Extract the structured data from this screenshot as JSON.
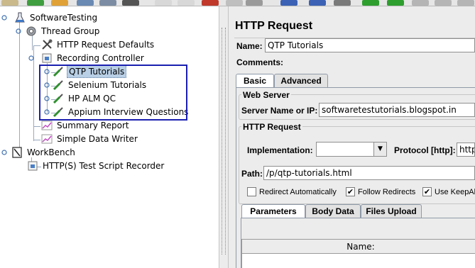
{
  "tree": {
    "items": [
      {
        "label": "SoftwareTesting",
        "icon": "test-plan-icon"
      },
      {
        "label": "Thread Group",
        "icon": "gear-icon"
      },
      {
        "label": "HTTP Request Defaults",
        "icon": "wrench-icon"
      },
      {
        "label": "Recording Controller",
        "icon": "controller-icon"
      },
      {
        "label": "QTP Tutorials",
        "icon": "pipette-icon",
        "selected": true
      },
      {
        "label": "Selenium Tutorials",
        "icon": "pipette-icon"
      },
      {
        "label": "HP ALM QC",
        "icon": "pipette-icon"
      },
      {
        "label": "Appium Interview Questions",
        "icon": "pipette-icon"
      },
      {
        "label": "Summary Report",
        "icon": "chart-icon"
      },
      {
        "label": "Simple Data Writer",
        "icon": "chart-icon"
      },
      {
        "label": "WorkBench",
        "icon": "workbench-icon"
      },
      {
        "label": "HTTP(S) Test Script Recorder",
        "icon": "recorder-icon"
      }
    ]
  },
  "panel": {
    "title": "HTTP Request",
    "name_label": "Name:",
    "name_value": "QTP Tutorials",
    "comments_label": "Comments:",
    "tabs": [
      "Basic",
      "Advanced"
    ],
    "web_server": {
      "title": "Web Server",
      "server_label": "Server Name or IP:",
      "server_value": "softwaretestutorials.blogspot.in"
    },
    "http_request": {
      "title": "HTTP Request",
      "implementation_label": "Implementation:",
      "implementation_value": "",
      "protocol_label": "Protocol [http]:",
      "protocol_value": "http",
      "path_label": "Path:",
      "path_value": "/p/qtp-tutorials.html"
    },
    "checkboxes": [
      {
        "label": "Redirect Automatically",
        "checked": false
      },
      {
        "label": "Follow Redirects",
        "checked": true
      },
      {
        "label": "Use KeepAli",
        "checked": true
      }
    ],
    "sub_tabs": [
      "Parameters",
      "Body Data",
      "Files Upload"
    ],
    "table_header": "Name:"
  },
  "colors": {
    "selection": "#b8cfe5",
    "highlight_box": "#1a1fb0",
    "panel_bg": "#ececec"
  }
}
